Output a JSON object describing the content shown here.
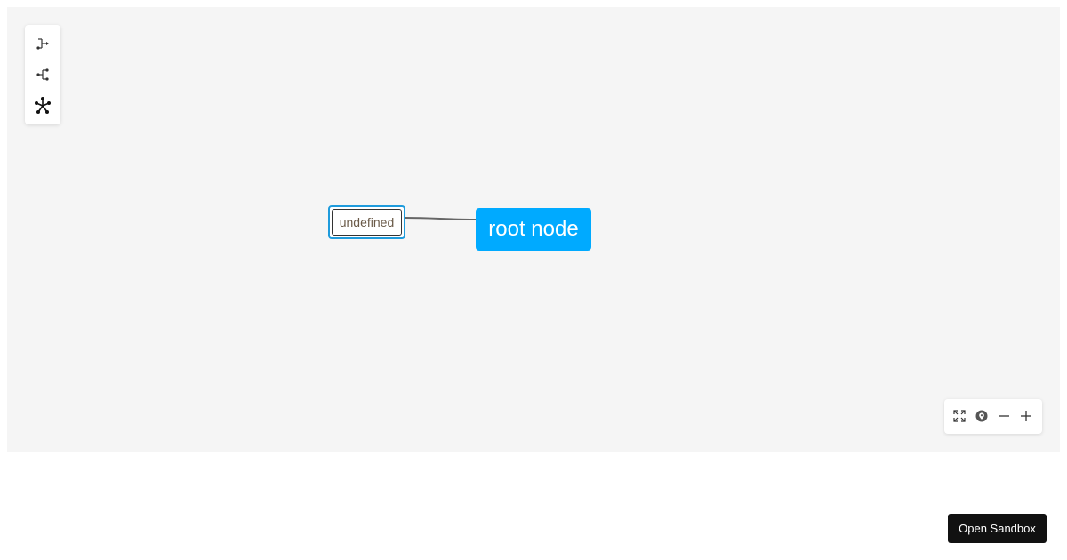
{
  "canvas": {
    "background": "#f5f5f5"
  },
  "layout_toolbar": {
    "items": [
      {
        "icon": "layout-right-tree-icon"
      },
      {
        "icon": "layout-left-tree-icon"
      },
      {
        "icon": "layout-radial-icon"
      }
    ]
  },
  "graph": {
    "root_node": {
      "label": "root node",
      "color": "#00aaff"
    },
    "child_node": {
      "label": "undefined",
      "border_color": "#1e9bdc"
    }
  },
  "zoom_toolbar": {
    "items": [
      {
        "icon": "fit-view-icon"
      },
      {
        "icon": "locate-icon"
      },
      {
        "icon": "zoom-out-icon"
      },
      {
        "icon": "zoom-in-icon"
      }
    ]
  },
  "sandbox_button": {
    "label": "Open Sandbox"
  }
}
